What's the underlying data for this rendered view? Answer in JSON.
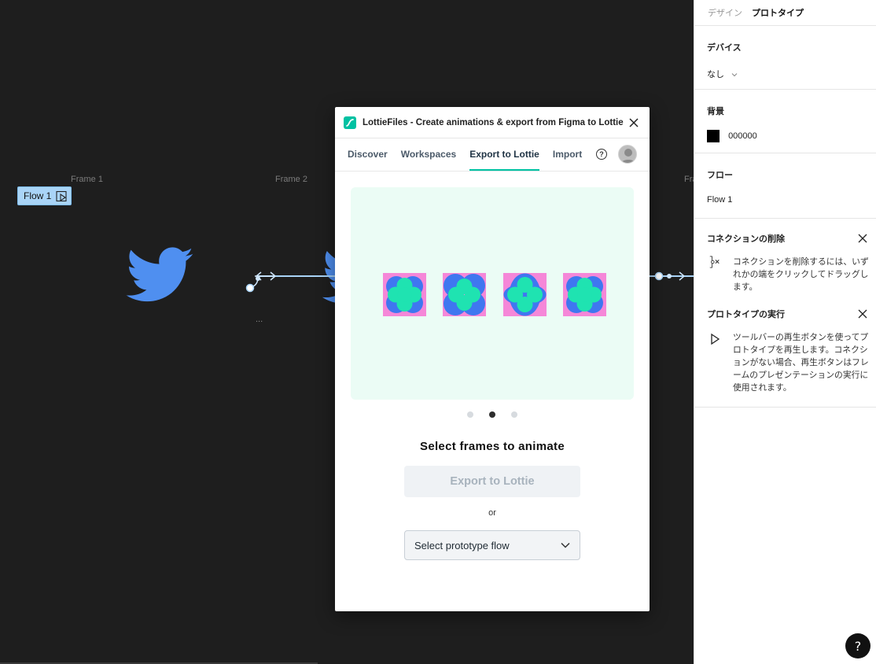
{
  "canvas": {
    "frames": [
      "Frame 1",
      "Frame 2",
      "Fra"
    ],
    "flow_tag": "Flow 1",
    "ellipsis": "..."
  },
  "plugin": {
    "title": "LottieFiles - Create animations & export from Figma to Lottie",
    "tabs": [
      {
        "label": "Discover",
        "active": false
      },
      {
        "label": "Workspaces",
        "active": false
      },
      {
        "label": "Export to Lottie",
        "active": true
      },
      {
        "label": "Import",
        "active": false
      }
    ],
    "help_glyph": "?",
    "carousel_active_index": 1,
    "select_title": "Select frames to animate",
    "export_button": "Export to Lottie",
    "or_text": "or",
    "flow_select_placeholder": "Select prototype flow",
    "accent_color": "#00c1a2"
  },
  "panel": {
    "tabs": [
      {
        "label": "デザイン",
        "active": false
      },
      {
        "label": "プロトタイプ",
        "active": true
      }
    ],
    "device": {
      "title": "デバイス",
      "value": "なし"
    },
    "background": {
      "title": "背景",
      "value": "000000",
      "color": "#000000"
    },
    "flow": {
      "title": "フロー",
      "value": "Flow 1"
    },
    "delete_connection": {
      "title": "コネクションの削除",
      "body": "コネクションを削除するには、いずれかの端をクリックしてドラッグします。"
    },
    "run_prototype": {
      "title": "プロトタイプの実行",
      "body": "ツールバーの再生ボタンを使ってプロトタイプを再生します。コネクションがない場合、再生ボタンはフレームのプレゼンテーションの実行に使用されます。"
    }
  },
  "help_fab": "?"
}
